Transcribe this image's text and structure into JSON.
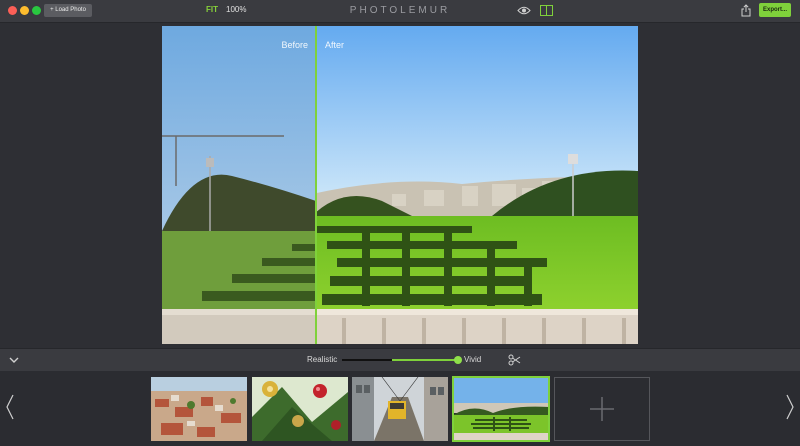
{
  "toolbar": {
    "load_label": "+ Load Photo",
    "fit_label": "FIT",
    "zoom_label": "100%",
    "brand": "PHOTOLEMUR",
    "export_label": "Export...",
    "icons": [
      "eye-icon",
      "split-view-icon",
      "share-icon"
    ]
  },
  "compare": {
    "before_label": "Before",
    "after_label": "After"
  },
  "adjust": {
    "left_label": "Realistic",
    "right_label": "Vivid",
    "slider_value_pct": 100
  },
  "colors": {
    "accent": "#7fd13b",
    "toolbar_bg": "#3a3b40",
    "window_bg": "#2e2f34"
  },
  "filmstrip": {
    "thumbnails": [
      {
        "label": "lisbon-rooftops-thumbnail"
      },
      {
        "label": "christmas-ornaments-thumbnail"
      },
      {
        "label": "tram-street-thumbnail"
      },
      {
        "label": "park-view-thumbnail",
        "selected": true
      }
    ],
    "add_icon": "plus-icon"
  }
}
